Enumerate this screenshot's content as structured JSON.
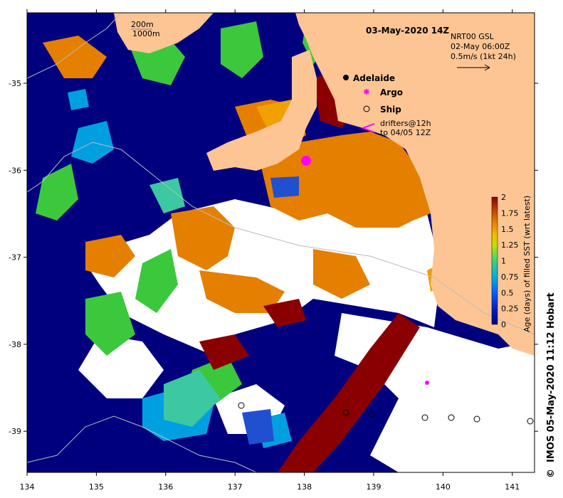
{
  "map": {
    "title": "03-May-2020 14Z",
    "model": "NRT00 GSL",
    "current_time": "02-May 06:00Z",
    "current_scale": "0.5m/s (1kt 24h)",
    "contours": [
      "200m",
      "1000m"
    ],
    "place": "Adelaide",
    "legend": {
      "argo": "Argo",
      "ship": "Ship",
      "drifters_line1": "drifters@12h",
      "drifters_line2": "to 04/05 12Z"
    },
    "colorbar": {
      "label": "Age (days) of filled SST (wrt latest)",
      "ticks": [
        "2",
        "1.75",
        "1.5",
        "1.25",
        "1",
        "0.75",
        "0.5",
        "0.25",
        "0"
      ],
      "range": [
        0,
        2
      ]
    },
    "x_ticks": [
      "134",
      "135",
      "136",
      "137",
      "138",
      "139",
      "140",
      "141"
    ],
    "y_ticks": [
      "-35",
      "-36",
      "-37",
      "-38",
      "-39"
    ],
    "credit": "IMOS 05-May-2020 11:12 Hobart",
    "colors": {
      "land": "#fdc594",
      "ocean_old": "#00007f",
      "age_2": "#8a0000",
      "age_1_5": "#e57f00",
      "age_1": "#3cc83c",
      "age_0_5": "#00a0e0",
      "missing": "#ffffff"
    }
  }
}
